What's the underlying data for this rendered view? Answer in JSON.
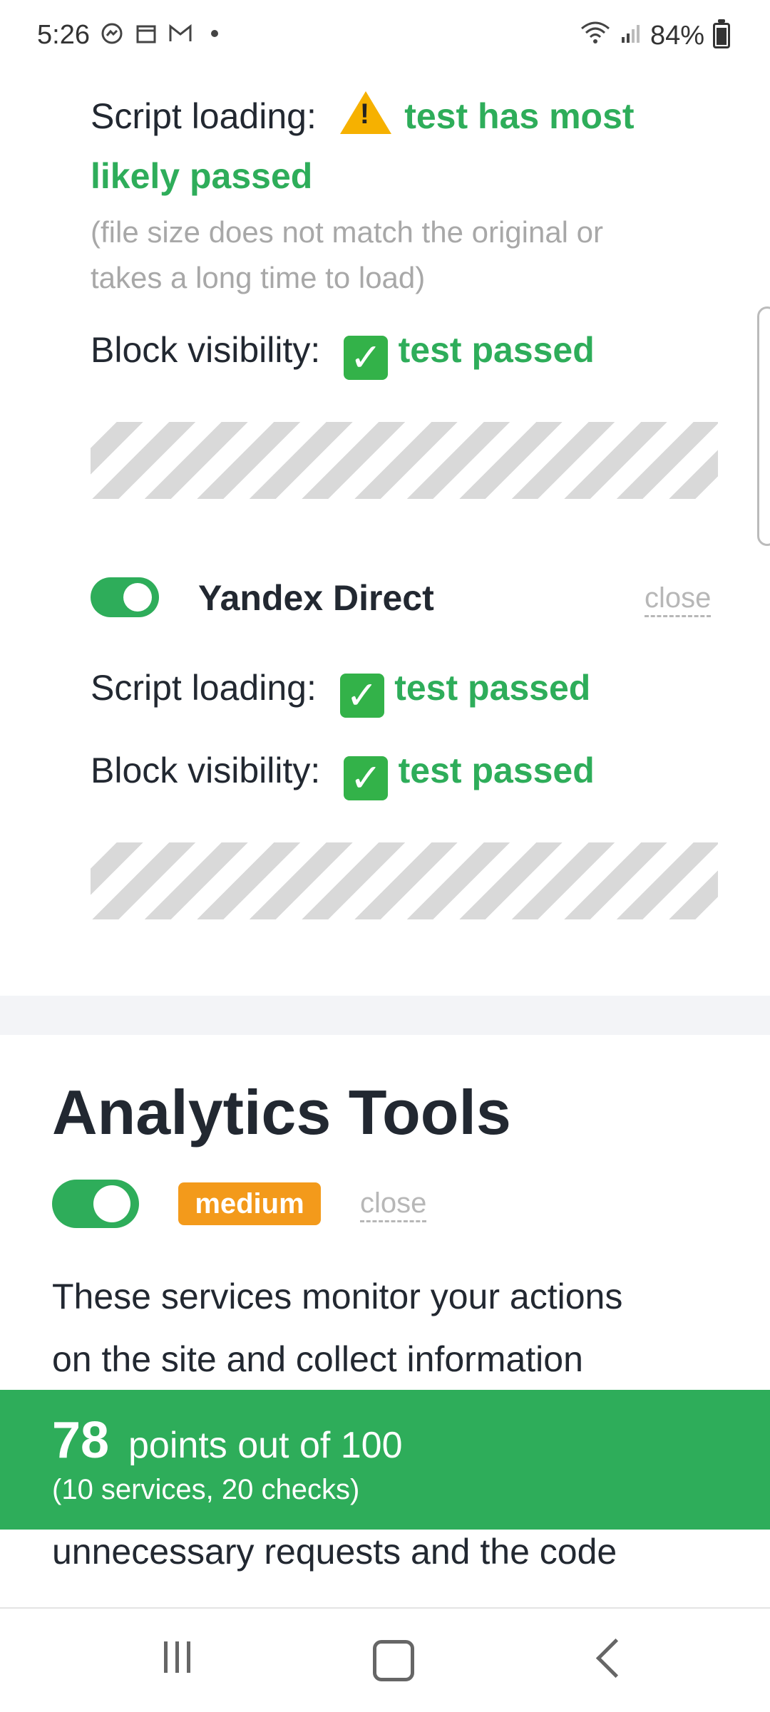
{
  "status_bar": {
    "time": "5:26",
    "battery_percent": "84%",
    "icons_left": [
      "messenger-icon",
      "calendar-icon",
      "gmail-icon",
      "dot-icon"
    ],
    "icons_right": [
      "wifi-icon",
      "signal-icon",
      "battery-icon"
    ]
  },
  "block1": {
    "script_loading_label": "Script loading:",
    "script_loading_status_line1": "test has most",
    "script_loading_status_line2": "likely passed",
    "note_line1": "(file size does not match the original or",
    "note_line2": "takes a long time to load)",
    "block_visibility_label": "Block visibility:",
    "block_visibility_status": "test passed"
  },
  "yandex": {
    "name": "Yandex Direct",
    "close_label": "close",
    "toggle_on": true,
    "script_loading_label": "Script loading:",
    "script_loading_status": "test passed",
    "block_visibility_label": "Block visibility:",
    "block_visibility_status": "test passed"
  },
  "analytics": {
    "title": "Analytics Tools",
    "toggle_on": true,
    "badge": "medium",
    "close_label": "close",
    "desc_line1": "These services monitor your actions",
    "desc_line2": "on the site and collect information",
    "desc_line3": "unnecessary requests and the code"
  },
  "score": {
    "points": "78",
    "points_text": "points out of 100",
    "details": "(10 services, 20 checks)"
  },
  "colors": {
    "green": "#2ead5a",
    "badge_orange": "#f39a1b",
    "grey_text": "#a8a8a8"
  }
}
